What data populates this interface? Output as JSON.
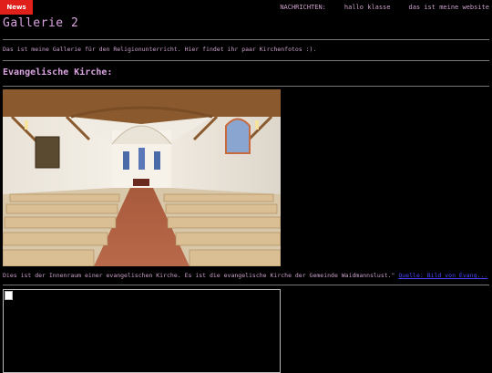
{
  "header": {
    "news_tab": "News",
    "nav": [
      "NACHRICHTEN:",
      "hallo klasse",
      "das ist meine website"
    ]
  },
  "page": {
    "title": "Gallerie 2",
    "intro": "Das ist meine Gallerie für den Religionunterricht. Hier findet ihr paar Kirchenfotos :).",
    "section_title": "Evangelische Kirche:",
    "caption": "Dies ist der Innenraum einer evangelischen Kirche. Es ist die evangelische Kirche der Gemeinde Waidmannslust.\"",
    "caption_link": "Quelle: Bild von Evang..."
  },
  "images": {
    "church_interior_alt": "Innenraum der evangelischen Kirche",
    "broken_image_alt": ""
  },
  "colors": {
    "background": "#000000",
    "text": "#c9a0c9",
    "heading": "#d9a3e0",
    "news_tab": "#e0201a",
    "link": "#4b45ff"
  }
}
